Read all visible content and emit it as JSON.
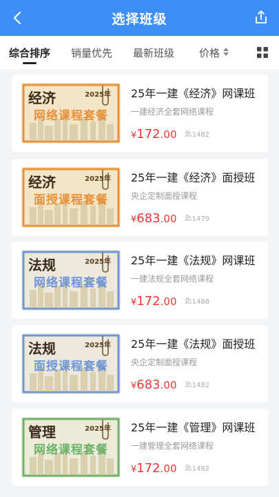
{
  "header": {
    "title": "选择班级"
  },
  "tabs": [
    {
      "label": "综合排序"
    },
    {
      "label": "销量优先"
    },
    {
      "label": "最新班级"
    },
    {
      "label": "价格"
    }
  ],
  "courses": [
    {
      "title": "25年一建《经济》网课班",
      "subtitle": "一建经济全套网络课程",
      "currency": "¥",
      "price_int": "172",
      "price_dec": ".00",
      "count": "1482",
      "thumb_subject": "经济",
      "thumb_kind": "网络课程套餐",
      "thumb_year": "2025年",
      "thumb_theme": "orange",
      "thumb_kind_color": "#e8903a",
      "thumb_bg": "#f3e6c8"
    },
    {
      "title": "25年一建《经济》面授班",
      "subtitle": "央企定制面授课程",
      "currency": "¥",
      "price_int": "683",
      "price_dec": ".00",
      "count": "1479",
      "thumb_subject": "经济",
      "thumb_kind": "面授课程套餐",
      "thumb_year": "2025年",
      "thumb_theme": "orange",
      "thumb_kind_color": "#e8903a",
      "thumb_bg": "#f3e6c8"
    },
    {
      "title": "25年一建《法规》网课班",
      "subtitle": "一建法规全套网络课程",
      "currency": "¥",
      "price_int": "172",
      "price_dec": ".00",
      "count": "1488",
      "thumb_subject": "法规",
      "thumb_kind": "网络课程套餐",
      "thumb_year": "2025年",
      "thumb_theme": "blue",
      "thumb_kind_color": "#6e95d6",
      "thumb_bg": "#ece8dc"
    },
    {
      "title": "25年一建《法规》面授班",
      "subtitle": "央企定制面授课程",
      "currency": "¥",
      "price_int": "683",
      "price_dec": ".00",
      "count": "1482",
      "thumb_subject": "法规",
      "thumb_kind": "面授课程套餐",
      "thumb_year": "2025年",
      "thumb_theme": "blue",
      "thumb_kind_color": "#6e95d6",
      "thumb_bg": "#ece8dc"
    },
    {
      "title": "25年一建《管理》网课班",
      "subtitle": "一建管理全套网络课程",
      "currency": "¥",
      "price_int": "172",
      "price_dec": ".00",
      "count": "1482",
      "thumb_subject": "管理",
      "thumb_kind": "网络课程套餐",
      "thumb_year": "2025年",
      "thumb_theme": "green",
      "thumb_kind_color": "#6bb36b",
      "thumb_bg": "#ecebd8"
    }
  ],
  "colors": {
    "primary": "#3d8ef7",
    "price": "#e8382f"
  }
}
